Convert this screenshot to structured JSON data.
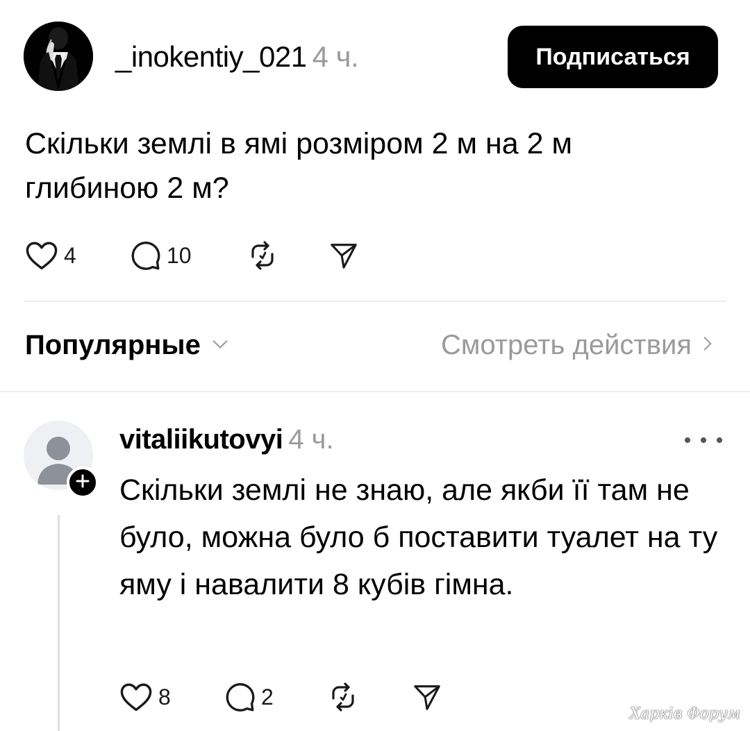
{
  "post": {
    "author": "_inokentiy_021",
    "time": "4 ч.",
    "follow_label": "Подписаться",
    "text": "Скільки землі в ямі розміром 2 м на 2 м глибиною 2 м?",
    "likes": "4",
    "comments": "10"
  },
  "sort": {
    "label": "Популярные",
    "view_activity": "Смотреть действия"
  },
  "reply": {
    "author": "vitaliikutovyi",
    "time": "4 ч.",
    "text": "Скільки землі не знаю, але якби її там не було, можна було б поставити туалет на ту яму і навалити 8 кубів гімна.",
    "likes": "8",
    "comments": "2"
  },
  "watermark": "Харків Форум",
  "icons": {
    "like": "heart-icon",
    "comment": "comment-bubble-icon",
    "repost": "repost-icon",
    "share": "send-icon",
    "chevron_down": "chevron-down-icon",
    "chevron_right": "chevron-right-icon",
    "more": "more-dots-icon",
    "follow_badge": "plus-icon"
  }
}
